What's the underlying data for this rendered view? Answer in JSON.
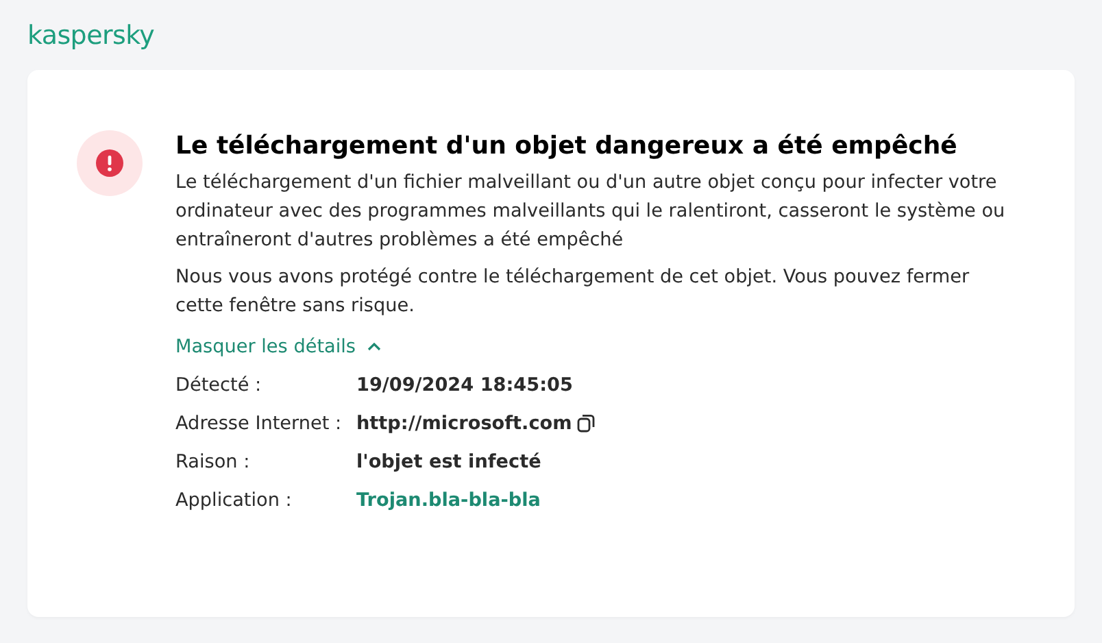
{
  "logo": "kaspersky",
  "title": "Le téléchargement d'un objet dangereux a été empêché",
  "paragraphs": [
    "Le téléchargement d'un fichier malveillant ou d'un autre objet conçu pour infecter votre ordinateur avec des programmes malveillants qui le ralentiront, casseront le système ou entraîneront d'autres problèmes a été empêché",
    "Nous vous avons protégé contre le téléchargement de cet objet. Vous pouvez fermer cette fenêtre sans risque."
  ],
  "details_toggle": {
    "label": "Masquer les détails",
    "expanded": true
  },
  "details": [
    {
      "label": "Détecté :",
      "value": "19/09/2024 18:45:05",
      "kind": "text"
    },
    {
      "label": "Adresse Internet :",
      "value": "http://microsoft.com",
      "kind": "url"
    },
    {
      "label": "Raison :",
      "value": "l'objet est infecté",
      "kind": "text"
    },
    {
      "label": "Application :",
      "value": "Trojan.bla-bla-bla",
      "kind": "link"
    }
  ]
}
